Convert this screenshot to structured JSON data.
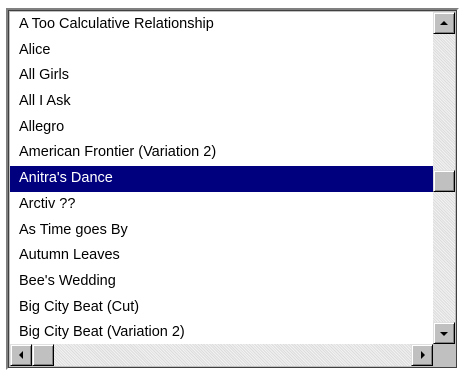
{
  "listbox": {
    "selected_index": 6,
    "items": [
      "A Too Calculative Relationship",
      "Alice",
      "All Girls",
      "All I Ask",
      "Allegro",
      "American Frontier (Variation 2)",
      "Anitra's Dance",
      "Arctiv ??",
      "As Time goes By",
      "Autumn Leaves",
      "Bee's Wedding",
      "Big City Beat (Cut)",
      "Big City Beat (Variation 2)"
    ]
  },
  "scrollbars": {
    "vertical": {
      "up_icon": "arrow-up-icon",
      "down_icon": "arrow-down-icon"
    },
    "horizontal": {
      "left_icon": "arrow-left-icon",
      "right_icon": "arrow-right-icon"
    }
  },
  "colors": {
    "selection_bg": "#00007f",
    "selection_fg": "#ffffff",
    "list_bg": "#ffffff",
    "chrome": "#c0c0c0"
  }
}
